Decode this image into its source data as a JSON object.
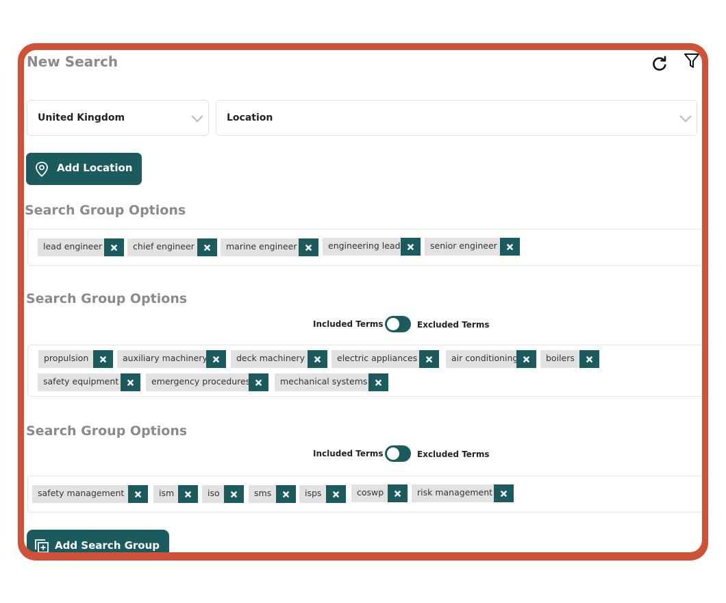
{
  "header": {
    "title": "New Search",
    "refresh_icon": "refresh-icon",
    "filter_icon": "filter-icon"
  },
  "location": {
    "country_value": "United  Kingdom",
    "location_value": "Location",
    "add_label": "Add Location"
  },
  "groups": [
    {
      "heading": "Search Group Options",
      "tags": [
        "lead engineer",
        "chief engineer",
        "marine engineer",
        "engineering lead",
        "senior engineer"
      ]
    },
    {
      "heading": "Search Group Options",
      "included_label": "Included Terms",
      "excluded_label": "Excluded Terms",
      "tags": [
        "propulsion",
        "auxiliary machinery",
        "deck machinery",
        "electric appliances",
        "air conditioning",
        "boilers",
        "safety equipment",
        "emergency procedures",
        "mechanical systems"
      ]
    },
    {
      "heading": "Search Group Options",
      "included_label": "Included Terms",
      "excluded_label": "Excluded Terms",
      "tags": [
        "safety management",
        "ism",
        "iso",
        "sms",
        "isps",
        "coswp",
        "risk management"
      ]
    }
  ],
  "footer": {
    "add_group_label": "Add Search Group"
  },
  "colors": {
    "frame": "#cf5238",
    "accent": "#1b5b5e",
    "chip_bg": "#e2e2e2",
    "heading": "#8a8a8a"
  }
}
